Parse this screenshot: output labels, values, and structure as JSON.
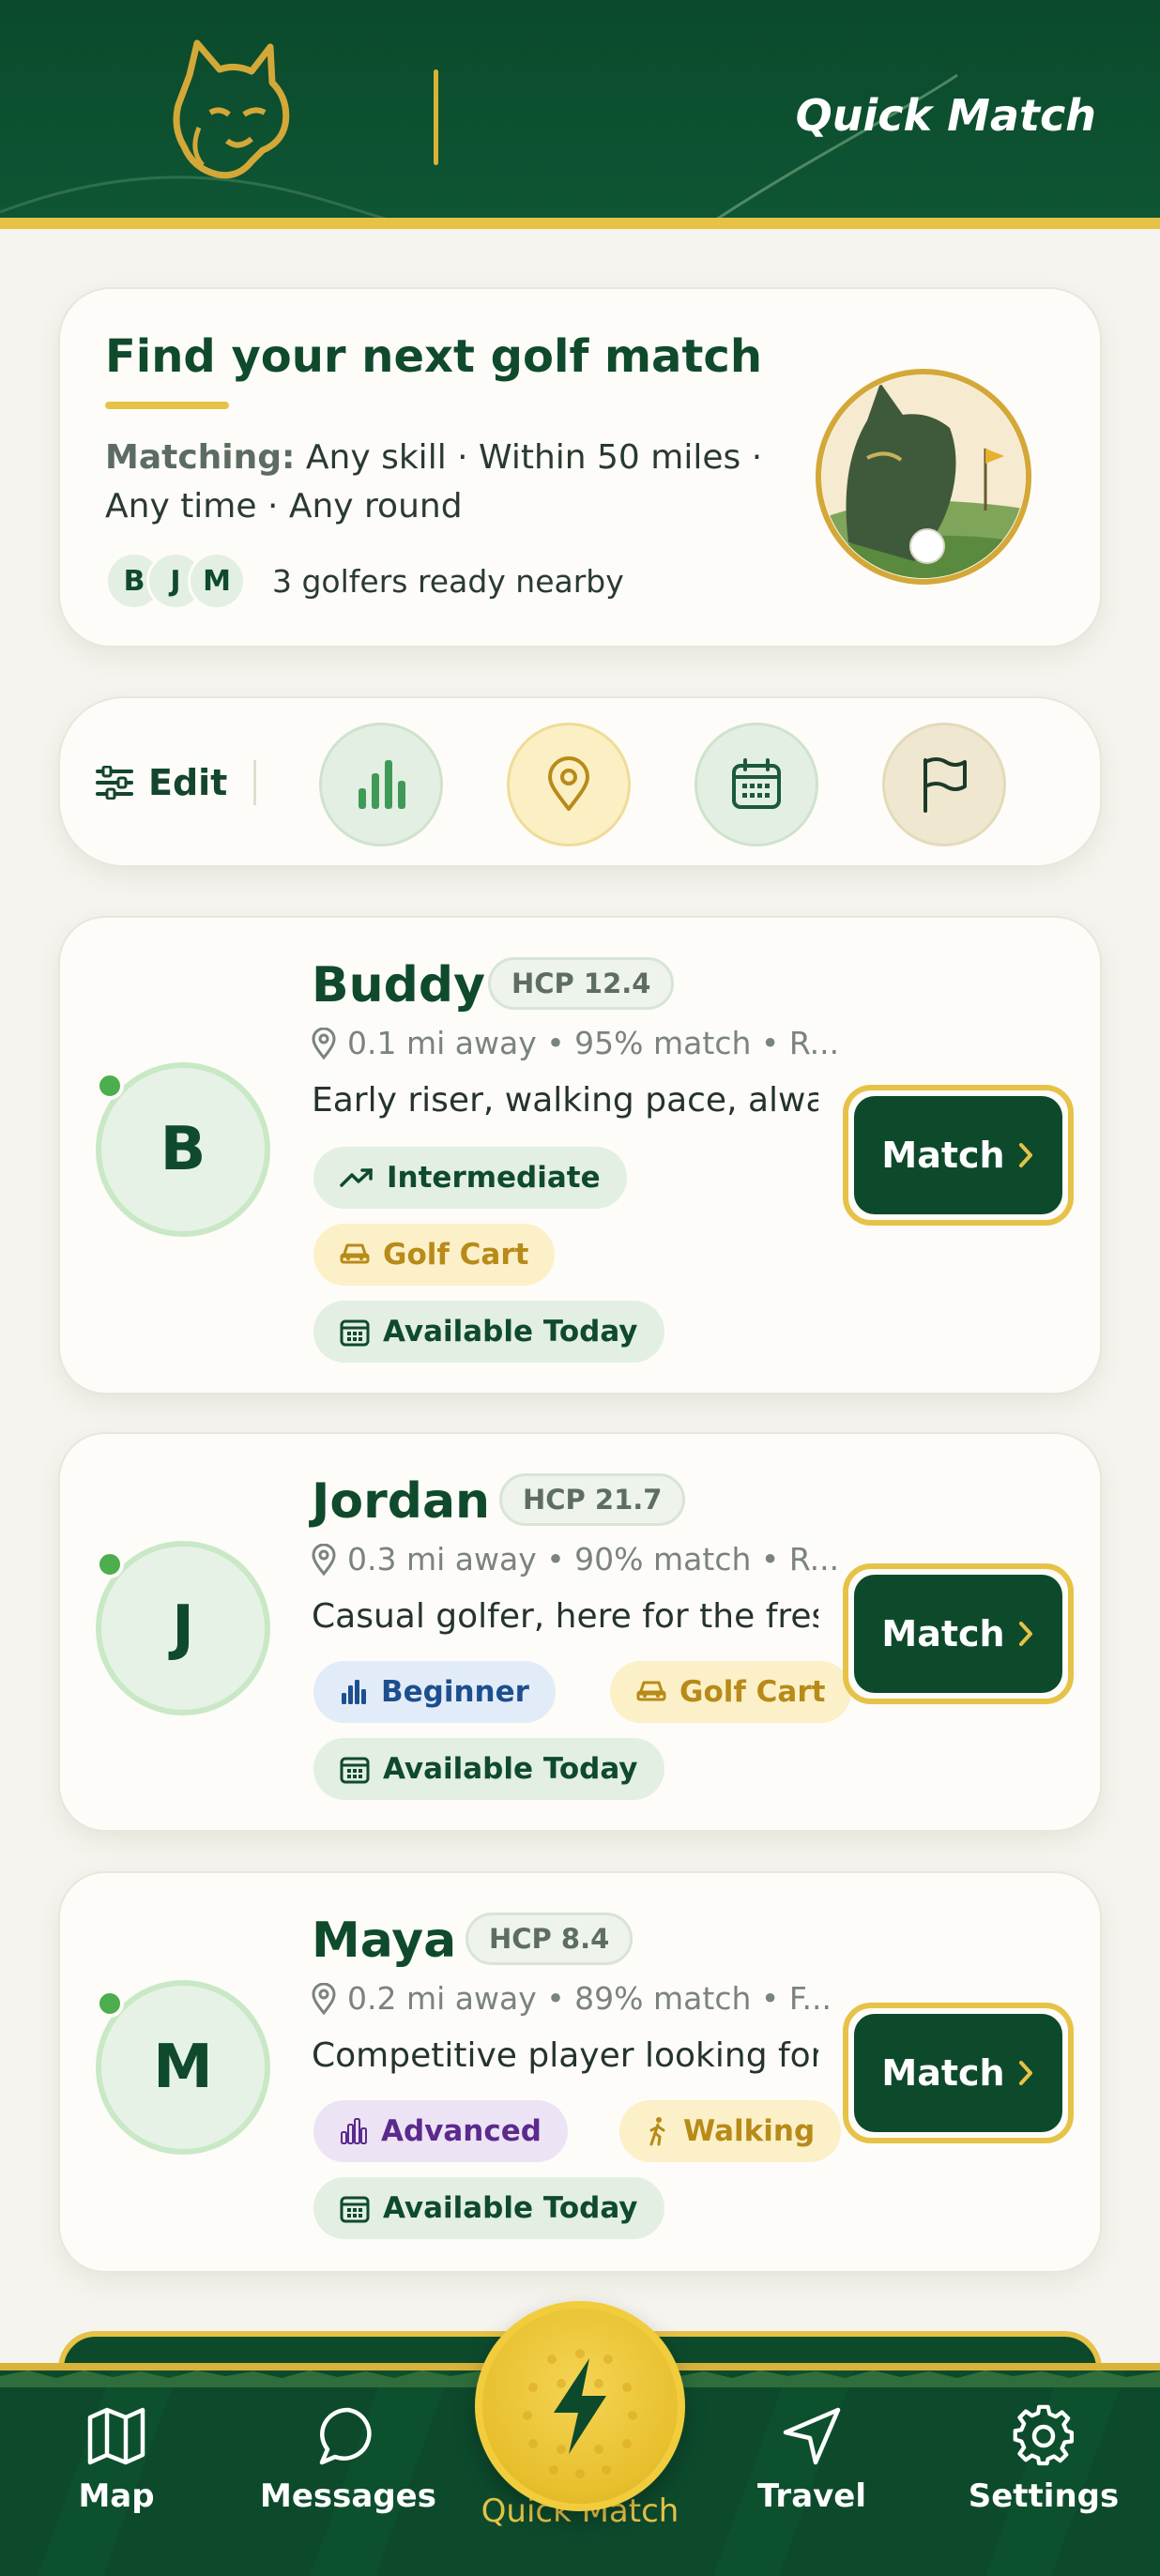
{
  "header": {
    "title": "Quick Match"
  },
  "hero": {
    "title": "Find your next golf match",
    "matching_label": "Matching:",
    "matching_line1": "Any skill  ·  Within 50 miles  ·",
    "matching_line2": "Any time  ·  Any round",
    "avatars": [
      "B",
      "J",
      "M"
    ],
    "ready_text": "3 golfers ready nearby"
  },
  "filters": {
    "edit_label": "Edit"
  },
  "players": [
    {
      "initial": "B",
      "name": "Buddy",
      "hcp": "HCP 12.4",
      "meta": "0.1 mi away • 95% match • R...",
      "bio": "Early riser, walking pace, alway...",
      "chips": [
        {
          "label": "Intermediate",
          "style": "green",
          "icon": "trend-up-icon"
        },
        {
          "label": "Golf Cart",
          "style": "gold",
          "icon": "cart-icon"
        },
        {
          "label": "Available Today",
          "style": "green",
          "icon": "calendar-icon"
        }
      ],
      "match_label": "Match"
    },
    {
      "initial": "J",
      "name": "Jordan",
      "hcp": "HCP 21.7",
      "meta": "0.3 mi away • 90% match • R...",
      "bio": "Casual golfer, here for the fres...",
      "chips": [
        {
          "label": "Beginner",
          "style": "blue",
          "icon": "bar-chart-icon"
        },
        {
          "label": "Golf Cart",
          "style": "gold",
          "icon": "cart-icon"
        },
        {
          "label": "Available Today",
          "style": "green",
          "icon": "calendar-icon"
        }
      ],
      "match_label": "Match"
    },
    {
      "initial": "M",
      "name": "Maya",
      "hcp": "HCP 8.4",
      "meta": "0.2 mi away • 89% match • F...",
      "bio": "Competitive player looking for...",
      "chips": [
        {
          "label": "Advanced",
          "style": "purple",
          "icon": "bar-chart-icon"
        },
        {
          "label": "Walking",
          "style": "gold",
          "icon": "walking-icon"
        },
        {
          "label": "Available Today",
          "style": "green",
          "icon": "calendar-icon"
        }
      ],
      "match_label": "Match"
    }
  ],
  "nav": {
    "items": [
      {
        "label": "Map",
        "icon": "map-icon"
      },
      {
        "label": "Messages",
        "icon": "chat-icon"
      },
      {
        "label": "Quick Match",
        "icon": "lightning-icon",
        "active": true
      },
      {
        "label": "Travel",
        "icon": "navigation-icon"
      },
      {
        "label": "Settings",
        "icon": "gear-icon"
      }
    ]
  },
  "colors": {
    "brand_green": "#0d4a2c",
    "accent_gold": "#e6c247",
    "background": "#f6f4ee"
  }
}
